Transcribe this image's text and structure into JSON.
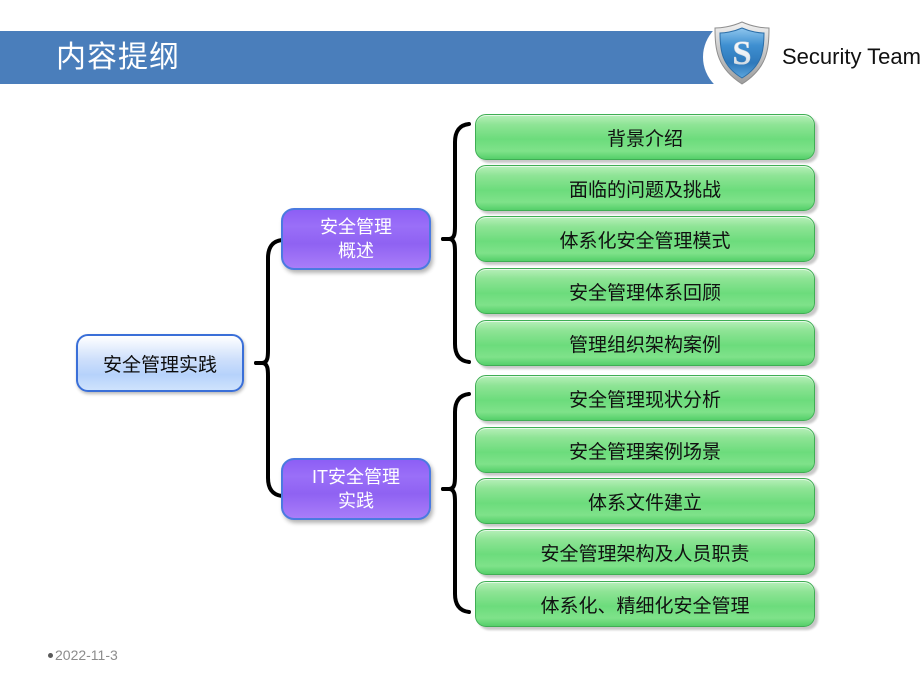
{
  "header": {
    "title": "内容提纲",
    "brand_name": "Security Team",
    "bar_color": "#4a7ebb",
    "logo_icon": "shield-s-icon"
  },
  "diagram": {
    "root": {
      "label": "安全管理实践"
    },
    "branches": [
      {
        "label": "安全管理\n概述",
        "leaves": [
          {
            "label": "背景介绍"
          },
          {
            "label": "面临的问题及挑战"
          },
          {
            "label": "体系化安全管理模式"
          },
          {
            "label": "安全管理体系回顾"
          },
          {
            "label": "管理组织架构案例"
          }
        ]
      },
      {
        "label": "IT安全管理\n实践",
        "leaves": [
          {
            "label": "安全管理现状分析"
          },
          {
            "label": "安全管理案例场景"
          },
          {
            "label": "体系文件建立"
          },
          {
            "label": "安全管理架构及人员职责"
          },
          {
            "label": "体系化、精细化安全管理"
          }
        ]
      }
    ],
    "colors": {
      "root_fill": "#bcd6fb",
      "root_border": "#3a6fd8",
      "branch_fill": "#9a6ff8",
      "branch_border": "#4a7ae0",
      "leaf_fill": "#6cdc7c",
      "leaf_border": "#3fae54",
      "connector": "#000000"
    }
  },
  "footer": {
    "date": "2022-11-3"
  }
}
